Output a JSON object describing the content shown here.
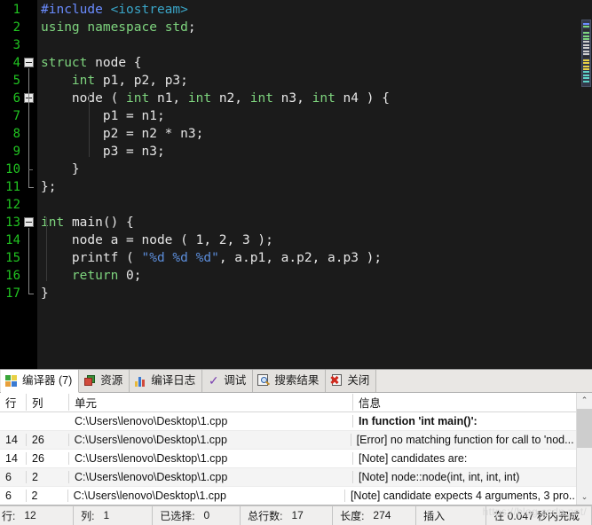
{
  "editor": {
    "gutter_line_numbers": [
      "1",
      "2",
      "3",
      "4",
      "5",
      "6",
      "7",
      "8",
      "9",
      "10",
      "11",
      "12",
      "13",
      "14",
      "15",
      "16",
      "17"
    ],
    "lines": [
      {
        "n": 1,
        "tokens": [
          {
            "t": "#include",
            "c": "pre"
          },
          {
            "t": " ",
            "c": "punc"
          },
          {
            "t": "<iostream>",
            "c": "inc"
          }
        ]
      },
      {
        "n": 2,
        "tokens": [
          {
            "t": "using",
            "c": "kw"
          },
          {
            "t": " ",
            "c": "punc"
          },
          {
            "t": "namespace",
            "c": "kw"
          },
          {
            "t": " ",
            "c": "punc"
          },
          {
            "t": "std",
            "c": "kw"
          },
          {
            "t": ";",
            "c": "punc"
          }
        ]
      },
      {
        "n": 3,
        "tokens": []
      },
      {
        "n": 4,
        "tokens": [
          {
            "t": "struct",
            "c": "kw"
          },
          {
            "t": " ",
            "c": "punc"
          },
          {
            "t": "node",
            "c": "id"
          },
          {
            "t": " {",
            "c": "punc"
          }
        ]
      },
      {
        "n": 5,
        "tokens": [
          {
            "t": "    ",
            "c": "punc"
          },
          {
            "t": "int",
            "c": "kw"
          },
          {
            "t": " ",
            "c": "punc"
          },
          {
            "t": "p1, p2, p3;",
            "c": "id"
          }
        ]
      },
      {
        "n": 6,
        "tokens": [
          {
            "t": "    ",
            "c": "punc"
          },
          {
            "t": "node ( ",
            "c": "id"
          },
          {
            "t": "int",
            "c": "kw"
          },
          {
            "t": " n1, ",
            "c": "id"
          },
          {
            "t": "int",
            "c": "kw"
          },
          {
            "t": " n2, ",
            "c": "id"
          },
          {
            "t": "int",
            "c": "kw"
          },
          {
            "t": " n3, ",
            "c": "id"
          },
          {
            "t": "int",
            "c": "kw"
          },
          {
            "t": " n4 ) {",
            "c": "id"
          }
        ]
      },
      {
        "n": 7,
        "tokens": [
          {
            "t": "        p1 = n1;",
            "c": "id"
          }
        ]
      },
      {
        "n": 8,
        "tokens": [
          {
            "t": "        p2 = n2 * n3;",
            "c": "id"
          }
        ]
      },
      {
        "n": 9,
        "tokens": [
          {
            "t": "        p3 = n3;",
            "c": "id"
          }
        ]
      },
      {
        "n": 10,
        "tokens": [
          {
            "t": "    }",
            "c": "punc"
          }
        ]
      },
      {
        "n": 11,
        "tokens": [
          {
            "t": "};",
            "c": "punc"
          }
        ]
      },
      {
        "n": 12,
        "tokens": []
      },
      {
        "n": 13,
        "tokens": [
          {
            "t": "int",
            "c": "kw"
          },
          {
            "t": " ",
            "c": "punc"
          },
          {
            "t": "main() {",
            "c": "id"
          }
        ]
      },
      {
        "n": 14,
        "tokens": [
          {
            "t": "    node a = node ( 1, 2, 3 );",
            "c": "id"
          }
        ]
      },
      {
        "n": 15,
        "tokens": [
          {
            "t": "    printf ( ",
            "c": "id"
          },
          {
            "t": "\"%d %d %d\"",
            "c": "str"
          },
          {
            "t": ", a.p1, a.p2, a.p3 );",
            "c": "id"
          }
        ]
      },
      {
        "n": 16,
        "tokens": [
          {
            "t": "    ",
            "c": "punc"
          },
          {
            "t": "return",
            "c": "kw"
          },
          {
            "t": " 0;",
            "c": "id"
          }
        ]
      },
      {
        "n": 17,
        "tokens": [
          {
            "t": "}",
            "c": "punc"
          }
        ]
      }
    ],
    "fold_markers": [
      4,
      6,
      13
    ],
    "colors": {
      "gutter_bg": "#000000",
      "code_bg": "#1b1b1b",
      "line_number": "#21c421",
      "keyword": "#7ed47e",
      "preprocessor": "#6a8cff",
      "include_path": "#3aa6c8",
      "string": "#5b8cd8",
      "text": "#e6e6e6"
    }
  },
  "panel": {
    "tabs": [
      {
        "label": "编译器 (7)",
        "icon": "compiler-icon",
        "active": true
      },
      {
        "label": "资源",
        "icon": "resource-icon",
        "active": false
      },
      {
        "label": "编译日志",
        "icon": "build-log-icon",
        "active": false
      },
      {
        "label": "调试",
        "icon": "debug-check-icon",
        "active": false
      },
      {
        "label": "搜索结果",
        "icon": "search-results-icon",
        "active": false
      },
      {
        "label": "关闭",
        "icon": "close-icon",
        "active": false
      }
    ],
    "table": {
      "headers": [
        "行",
        "列",
        "单元",
        "信息"
      ],
      "rows": [
        {
          "line": "",
          "col": "",
          "unit": "C:\\Users\\lenovo\\Desktop\\1.cpp",
          "info": "In function 'int main()':",
          "bold": true,
          "alt": false
        },
        {
          "line": "14",
          "col": "26",
          "unit": "C:\\Users\\lenovo\\Desktop\\1.cpp",
          "info": "[Error] no matching function for call to 'nod...",
          "bold": false,
          "alt": true
        },
        {
          "line": "14",
          "col": "26",
          "unit": "C:\\Users\\lenovo\\Desktop\\1.cpp",
          "info": "[Note] candidates are:",
          "bold": false,
          "alt": false
        },
        {
          "line": "6",
          "col": "2",
          "unit": "C:\\Users\\lenovo\\Desktop\\1.cpp",
          "info": "[Note] node::node(int, int, int, int)",
          "bold": false,
          "alt": true
        },
        {
          "line": "6",
          "col": "2",
          "unit": "C:\\Users\\lenovo\\Desktop\\1.cpp",
          "info": "[Note] candidate expects 4 arguments, 3 pro...",
          "bold": false,
          "alt": false
        }
      ]
    },
    "scrollbar": {
      "up_arrow": "⌃",
      "down_arrow": "⌄"
    }
  },
  "statusbar": {
    "items": [
      {
        "key": "行:",
        "value": "12"
      },
      {
        "key": "列:",
        "value": "1"
      },
      {
        "key": "已选择:",
        "value": "0"
      },
      {
        "key": "总行数:",
        "value": "17"
      },
      {
        "key": "长度:",
        "value": "274"
      },
      {
        "key": "插入",
        "value": ""
      },
      {
        "key": "在 0.047 秒内完成",
        "value": ""
      }
    ],
    "watermark": "https://blog.csdn.net/"
  }
}
